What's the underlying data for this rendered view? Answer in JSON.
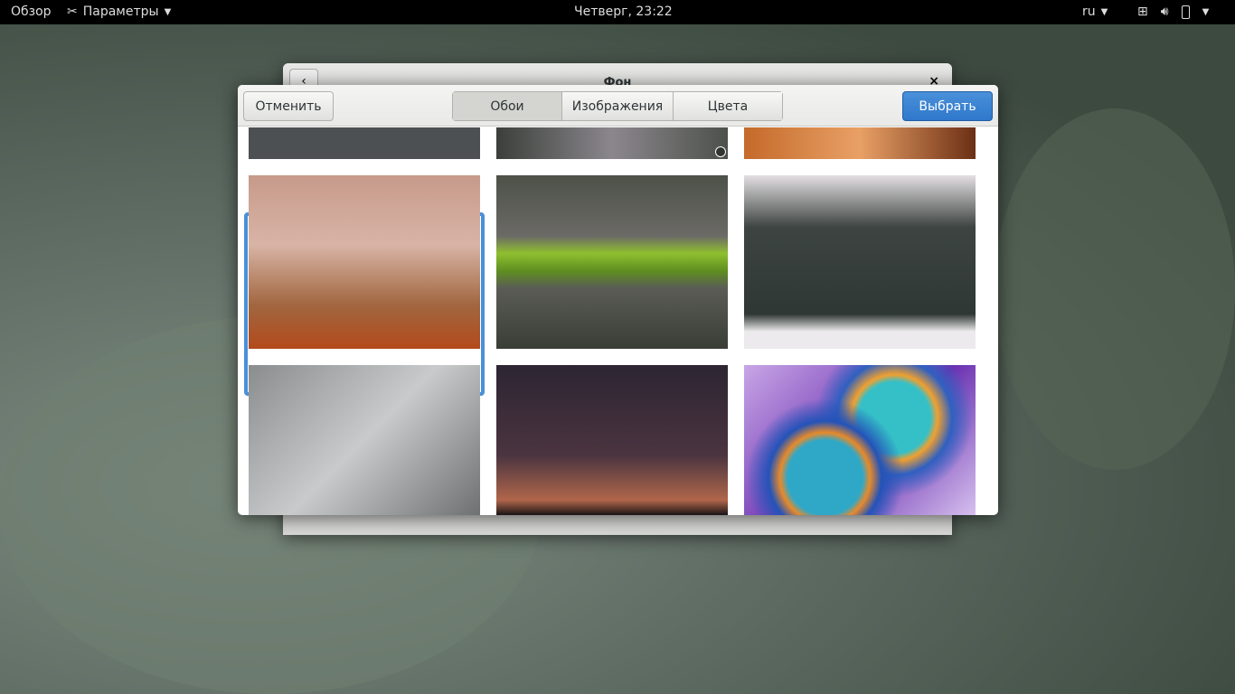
{
  "topbar": {
    "activities": "Обзор",
    "app_menu": "Параметры",
    "clock": "Четверг, 23:22",
    "keyboard_layout": "ru"
  },
  "back_window": {
    "title": "Фон"
  },
  "dialog": {
    "cancel": "Отменить",
    "select": "Выбрать",
    "tabs": [
      {
        "label": "Обои",
        "active": true
      },
      {
        "label": "Изображения",
        "active": false
      },
      {
        "label": "Цвета",
        "active": false
      }
    ]
  },
  "wallpapers": [
    "abstract-lines",
    "gray-blur",
    "orange-tentacles",
    "autumn-forest",
    "green-spiral",
    "snowy-forest",
    "concrete-building",
    "night-sky",
    "colorful-rings"
  ],
  "selected_index": 3
}
